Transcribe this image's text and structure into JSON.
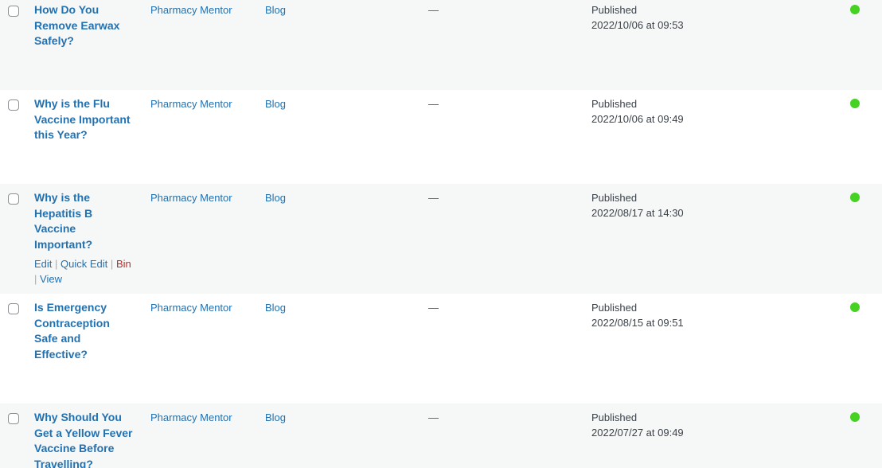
{
  "rows": [
    {
      "title": "How Do You Remove Earwax Safely?",
      "author": "Pharmacy Mentor",
      "category": "Blog",
      "tags": "—",
      "date_status": "Published",
      "date_value": "2022/10/06 at 09:53",
      "status_color": "#46d223"
    },
    {
      "title": "Why is the Flu Vaccine Important this Year?",
      "author": "Pharmacy Mentor",
      "category": "Blog",
      "tags": "—",
      "date_status": "Published",
      "date_value": "2022/10/06 at 09:49",
      "status_color": "#46d223"
    },
    {
      "title": "Why is the Hepatitis B Vaccine Important?",
      "author": "Pharmacy Mentor",
      "category": "Blog",
      "tags": "—",
      "date_status": "Published",
      "date_value": "2022/08/17 at 14:30",
      "status_color": "#46d223",
      "actions": {
        "edit": "Edit",
        "quick_edit": "Quick Edit",
        "bin": "Bin",
        "view": "View",
        "separator": "|"
      }
    },
    {
      "title": "Is Emergency Contraception Safe and Effective?",
      "author": "Pharmacy Mentor",
      "category": "Blog",
      "tags": "—",
      "date_status": "Published",
      "date_value": "2022/08/15 at 09:51",
      "status_color": "#46d223"
    },
    {
      "title": "Why Should You Get a Yellow Fever Vaccine Before Travelling?",
      "author": "Pharmacy Mentor",
      "category": "Blog",
      "tags": "—",
      "date_status": "Published",
      "date_value": "2022/07/27 at 09:49",
      "status_color": "#46d223"
    }
  ],
  "colors": {
    "link": "#2271b1",
    "trash": "#b32d2e",
    "alt_row": "#f6f7f7",
    "status_published": "#46d223"
  }
}
